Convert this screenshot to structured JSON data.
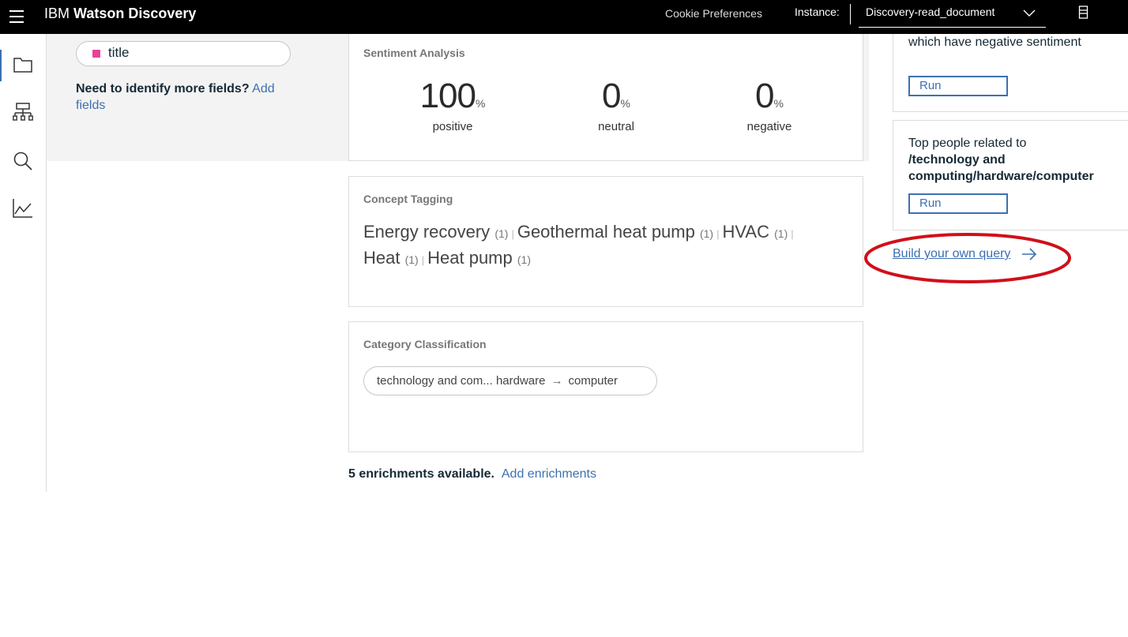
{
  "header": {
    "brand_prefix": "IBM",
    "brand_name": "Watson Discovery",
    "cookie_preferences": "Cookie Preferences",
    "instance_label": "Instance:",
    "instance_value": "Discovery-read_document"
  },
  "sidenav": {
    "items": [
      {
        "icon": "folder-icon",
        "active": true
      },
      {
        "icon": "hierarchy-icon",
        "active": false
      },
      {
        "icon": "search-icon",
        "active": false
      },
      {
        "icon": "chart-icon",
        "active": false
      }
    ]
  },
  "fields": {
    "title_field": "title",
    "need_more_text": "Need to identify more fields?",
    "add_fields_link": "Add fields"
  },
  "sentiment": {
    "title": "Sentiment Analysis",
    "items": [
      {
        "value": "100",
        "unit": "%",
        "label": "positive"
      },
      {
        "value": "0",
        "unit": "%",
        "label": "neutral"
      },
      {
        "value": "0",
        "unit": "%",
        "label": "negative"
      }
    ]
  },
  "concepts": {
    "title": "Concept Tagging",
    "items": [
      {
        "name": "Energy recovery",
        "count": "(1)"
      },
      {
        "name": "Geothermal heat pump",
        "count": "(1)"
      },
      {
        "name": "HVAC",
        "count": "(1)"
      },
      {
        "name": "Heat",
        "count": "(1)"
      },
      {
        "name": "Heat pump",
        "count": "(1)"
      }
    ],
    "separator": "|"
  },
  "category": {
    "title": "Category Classification",
    "path": [
      "technology and com...",
      "hardware",
      "computer"
    ],
    "arrow": "→"
  },
  "enrichments": {
    "available_text": "5 enrichments available.",
    "add_link": "Add enrichments"
  },
  "right_panel": {
    "card1": {
      "text": "which have negative sentiment",
      "run_label": "Run"
    },
    "card2": {
      "text_line1": "Top people related to",
      "text_bold": "/technology and computing/hardware/computer",
      "run_label": "Run"
    },
    "build_query_link": "Build your own query"
  },
  "annotation_color": "#d0101a",
  "accent_color": "#3d70b2"
}
